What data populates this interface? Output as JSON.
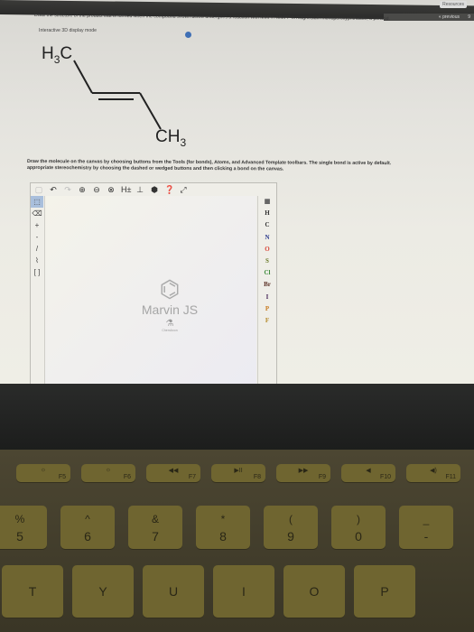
{
  "header": {
    "resources_label": "Resources",
    "previous_label": "« previous",
    "page_number": "9"
  },
  "question": {
    "text": "Draw the structure of the product that is formed when the compound shown below undergoes a reaction with MMPP. MMPP is magnesium monoperoxyphthalate, a peracid.",
    "mode_label": "Interactive 3D display mode"
  },
  "molecule": {
    "name": "trans-2-butene",
    "left_group": "H",
    "left_group_sub": "3",
    "left_group_c": "C",
    "right_group_c": "CH",
    "right_group_sub": "3"
  },
  "instructions": {
    "line1": "Draw the molecule on the canvas by choosing buttons from the Tools (for bonds), Atoms, and Advanced Template toolbars. The single bond is active by default.",
    "line2": "appropriate stereochemistry by choosing the dashed or wedged buttons and then clicking a bond on the canvas."
  },
  "editor": {
    "top_toolbar": [
      {
        "name": "new-document-icon",
        "glyph": "▢",
        "disabled": true
      },
      {
        "name": "undo-icon",
        "glyph": "↶",
        "disabled": false
      },
      {
        "name": "redo-icon",
        "glyph": "↷",
        "disabled": true
      },
      {
        "name": "zoom-in-icon",
        "glyph": "⊕",
        "disabled": false
      },
      {
        "name": "zoom-out-icon",
        "glyph": "⊖",
        "disabled": false
      },
      {
        "name": "zoom-fit-icon",
        "glyph": "⊗",
        "disabled": false
      },
      {
        "name": "hydrogen-toggle-icon",
        "glyph": "H±",
        "disabled": false
      },
      {
        "name": "cip-stereo-icon",
        "glyph": "⊥",
        "disabled": false
      },
      {
        "name": "info-icon",
        "glyph": "⬢",
        "disabled": false
      },
      {
        "name": "help-icon",
        "glyph": "❓",
        "disabled": false
      },
      {
        "name": "fullscreen-icon",
        "glyph": "⤢",
        "disabled": false
      }
    ],
    "left_toolbar": [
      {
        "name": "select-tool-icon",
        "glyph": "⬚",
        "active": true
      },
      {
        "name": "eraser-tool-icon",
        "glyph": "⌫",
        "active": false
      },
      {
        "name": "plus-charge-icon",
        "glyph": "+",
        "active": false
      },
      {
        "name": "minus-charge-icon",
        "glyph": "-",
        "active": false
      },
      {
        "name": "single-bond-icon",
        "glyph": "/",
        "active": false
      },
      {
        "name": "chain-tool-icon",
        "glyph": "⌇",
        "active": false
      },
      {
        "name": "bracket-tool-icon",
        "glyph": "[ ]",
        "active": false
      }
    ],
    "atoms": [
      {
        "symbol": "H",
        "color": "#333333"
      },
      {
        "symbol": "C",
        "color": "#333333"
      },
      {
        "symbol": "N",
        "color": "#2b3a8c"
      },
      {
        "symbol": "O",
        "color": "#d9483b"
      },
      {
        "symbol": "S",
        "color": "#6b7a2a"
      },
      {
        "symbol": "Cl",
        "color": "#3d8a3a"
      },
      {
        "symbol": "Br",
        "color": "#5a2f24"
      },
      {
        "symbol": "I",
        "color": "#4a2a5a"
      },
      {
        "symbol": "P",
        "color": "#c87a1f"
      },
      {
        "symbol": "F",
        "color": "#b58a2a"
      }
    ],
    "watermark": {
      "title": "Marvin JS",
      "brand": "ChemAxon"
    }
  },
  "keyboard": {
    "function_keys": [
      {
        "symbol": "☼",
        "label": "F5"
      },
      {
        "symbol": "☼",
        "label": "F6"
      },
      {
        "symbol": "◀◀",
        "label": "F7"
      },
      {
        "symbol": "▶II",
        "label": "F8"
      },
      {
        "symbol": "▶▶",
        "label": "F9"
      },
      {
        "symbol": "◀",
        "label": "F10"
      },
      {
        "symbol": "◀)",
        "label": "F11"
      }
    ],
    "number_keys": [
      {
        "top": "%",
        "bottom": "5"
      },
      {
        "top": "^",
        "bottom": "6"
      },
      {
        "top": "&",
        "bottom": "7"
      },
      {
        "top": "*",
        "bottom": "8"
      },
      {
        "top": "(",
        "bottom": "9"
      },
      {
        "top": ")",
        "bottom": "0"
      },
      {
        "top": "_",
        "bottom": "-"
      }
    ],
    "letter_keys": [
      "T",
      "Y",
      "U",
      "I",
      "O",
      "P"
    ]
  }
}
